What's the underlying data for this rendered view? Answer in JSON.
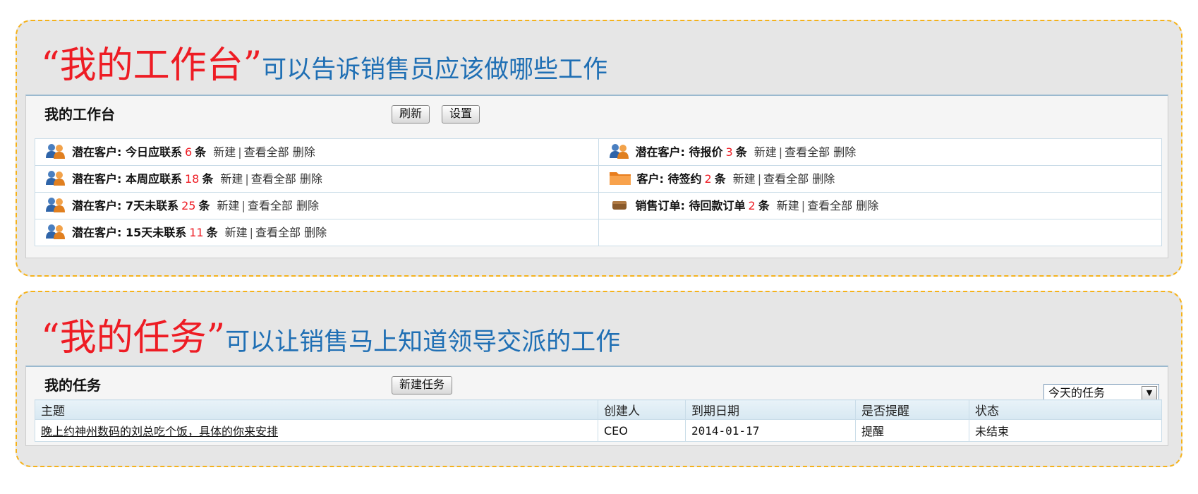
{
  "workbench_section": {
    "heading_quote": "“我的工作台”",
    "heading_desc": "可以告诉销售员应该做哪些工作",
    "panel_title": "我的工作台",
    "refresh_label": "刷新",
    "settings_label": "设置",
    "actions": {
      "new": "新建",
      "sep": "|",
      "view_all": "查看全部",
      "delete": "删除"
    },
    "unit": "条",
    "left_items": [
      {
        "label": "潜在客户: 今日应联系",
        "count": "6",
        "icon": "people-icon"
      },
      {
        "label": "潜在客户: 本周应联系",
        "count": "18",
        "icon": "people-icon"
      },
      {
        "label": "潜在客户: 7天未联系",
        "count": "25",
        "icon": "people-icon"
      },
      {
        "label": "潜在客户: 15天未联系",
        "count": "11",
        "icon": "people-icon"
      }
    ],
    "right_items": [
      {
        "label": "潜在客户: 待报价",
        "count": "3",
        "icon": "people-icon"
      },
      {
        "label": "客户: 待签约",
        "count": "2",
        "icon": "folder-icon"
      },
      {
        "label": "销售订单: 待回款订单",
        "count": "2",
        "icon": "order-icon"
      }
    ]
  },
  "task_section": {
    "heading_quote": "“我的任务”",
    "heading_desc": "可以让销售马上知道领导交派的工作",
    "panel_title": "我的任务",
    "new_task_label": "新建任务",
    "filter_selected": "今天的任务",
    "columns": [
      "主题",
      "创建人",
      "到期日期",
      "是否提醒",
      "状态"
    ],
    "rows": [
      {
        "subject": "晚上约神州数码的刘总吃个饭，具体的你来安排",
        "creator": "CEO",
        "due": "2014-01-17",
        "remind": "提醒",
        "status": "未结束"
      }
    ]
  },
  "colors": {
    "accent_red": "#ee1c24",
    "heading_blue": "#1f6fb4",
    "card_border": "#f5b21b"
  }
}
